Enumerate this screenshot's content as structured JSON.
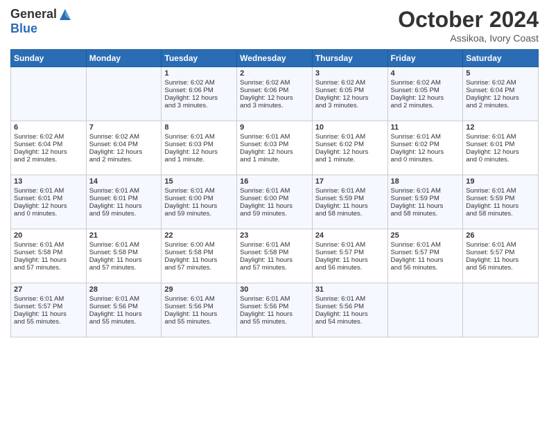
{
  "header": {
    "logo_general": "General",
    "logo_blue": "Blue",
    "month": "October 2024",
    "location": "Assikoa, Ivory Coast"
  },
  "weekdays": [
    "Sunday",
    "Monday",
    "Tuesday",
    "Wednesday",
    "Thursday",
    "Friday",
    "Saturday"
  ],
  "weeks": [
    [
      {
        "day": "",
        "content": ""
      },
      {
        "day": "",
        "content": ""
      },
      {
        "day": "1",
        "content": "Sunrise: 6:02 AM\nSunset: 6:06 PM\nDaylight: 12 hours\nand 3 minutes."
      },
      {
        "day": "2",
        "content": "Sunrise: 6:02 AM\nSunset: 6:06 PM\nDaylight: 12 hours\nand 3 minutes."
      },
      {
        "day": "3",
        "content": "Sunrise: 6:02 AM\nSunset: 6:05 PM\nDaylight: 12 hours\nand 3 minutes."
      },
      {
        "day": "4",
        "content": "Sunrise: 6:02 AM\nSunset: 6:05 PM\nDaylight: 12 hours\nand 2 minutes."
      },
      {
        "day": "5",
        "content": "Sunrise: 6:02 AM\nSunset: 6:04 PM\nDaylight: 12 hours\nand 2 minutes."
      }
    ],
    [
      {
        "day": "6",
        "content": "Sunrise: 6:02 AM\nSunset: 6:04 PM\nDaylight: 12 hours\nand 2 minutes."
      },
      {
        "day": "7",
        "content": "Sunrise: 6:02 AM\nSunset: 6:04 PM\nDaylight: 12 hours\nand 2 minutes."
      },
      {
        "day": "8",
        "content": "Sunrise: 6:01 AM\nSunset: 6:03 PM\nDaylight: 12 hours\nand 1 minute."
      },
      {
        "day": "9",
        "content": "Sunrise: 6:01 AM\nSunset: 6:03 PM\nDaylight: 12 hours\nand 1 minute."
      },
      {
        "day": "10",
        "content": "Sunrise: 6:01 AM\nSunset: 6:02 PM\nDaylight: 12 hours\nand 1 minute."
      },
      {
        "day": "11",
        "content": "Sunrise: 6:01 AM\nSunset: 6:02 PM\nDaylight: 12 hours\nand 0 minutes."
      },
      {
        "day": "12",
        "content": "Sunrise: 6:01 AM\nSunset: 6:01 PM\nDaylight: 12 hours\nand 0 minutes."
      }
    ],
    [
      {
        "day": "13",
        "content": "Sunrise: 6:01 AM\nSunset: 6:01 PM\nDaylight: 12 hours\nand 0 minutes."
      },
      {
        "day": "14",
        "content": "Sunrise: 6:01 AM\nSunset: 6:01 PM\nDaylight: 11 hours\nand 59 minutes."
      },
      {
        "day": "15",
        "content": "Sunrise: 6:01 AM\nSunset: 6:00 PM\nDaylight: 11 hours\nand 59 minutes."
      },
      {
        "day": "16",
        "content": "Sunrise: 6:01 AM\nSunset: 6:00 PM\nDaylight: 11 hours\nand 59 minutes."
      },
      {
        "day": "17",
        "content": "Sunrise: 6:01 AM\nSunset: 5:59 PM\nDaylight: 11 hours\nand 58 minutes."
      },
      {
        "day": "18",
        "content": "Sunrise: 6:01 AM\nSunset: 5:59 PM\nDaylight: 11 hours\nand 58 minutes."
      },
      {
        "day": "19",
        "content": "Sunrise: 6:01 AM\nSunset: 5:59 PM\nDaylight: 11 hours\nand 58 minutes."
      }
    ],
    [
      {
        "day": "20",
        "content": "Sunrise: 6:01 AM\nSunset: 5:58 PM\nDaylight: 11 hours\nand 57 minutes."
      },
      {
        "day": "21",
        "content": "Sunrise: 6:01 AM\nSunset: 5:58 PM\nDaylight: 11 hours\nand 57 minutes."
      },
      {
        "day": "22",
        "content": "Sunrise: 6:00 AM\nSunset: 5:58 PM\nDaylight: 11 hours\nand 57 minutes."
      },
      {
        "day": "23",
        "content": "Sunrise: 6:01 AM\nSunset: 5:58 PM\nDaylight: 11 hours\nand 57 minutes."
      },
      {
        "day": "24",
        "content": "Sunrise: 6:01 AM\nSunset: 5:57 PM\nDaylight: 11 hours\nand 56 minutes."
      },
      {
        "day": "25",
        "content": "Sunrise: 6:01 AM\nSunset: 5:57 PM\nDaylight: 11 hours\nand 56 minutes."
      },
      {
        "day": "26",
        "content": "Sunrise: 6:01 AM\nSunset: 5:57 PM\nDaylight: 11 hours\nand 56 minutes."
      }
    ],
    [
      {
        "day": "27",
        "content": "Sunrise: 6:01 AM\nSunset: 5:57 PM\nDaylight: 11 hours\nand 55 minutes."
      },
      {
        "day": "28",
        "content": "Sunrise: 6:01 AM\nSunset: 5:56 PM\nDaylight: 11 hours\nand 55 minutes."
      },
      {
        "day": "29",
        "content": "Sunrise: 6:01 AM\nSunset: 5:56 PM\nDaylight: 11 hours\nand 55 minutes."
      },
      {
        "day": "30",
        "content": "Sunrise: 6:01 AM\nSunset: 5:56 PM\nDaylight: 11 hours\nand 55 minutes."
      },
      {
        "day": "31",
        "content": "Sunrise: 6:01 AM\nSunset: 5:56 PM\nDaylight: 11 hours\nand 54 minutes."
      },
      {
        "day": "",
        "content": ""
      },
      {
        "day": "",
        "content": ""
      }
    ]
  ]
}
